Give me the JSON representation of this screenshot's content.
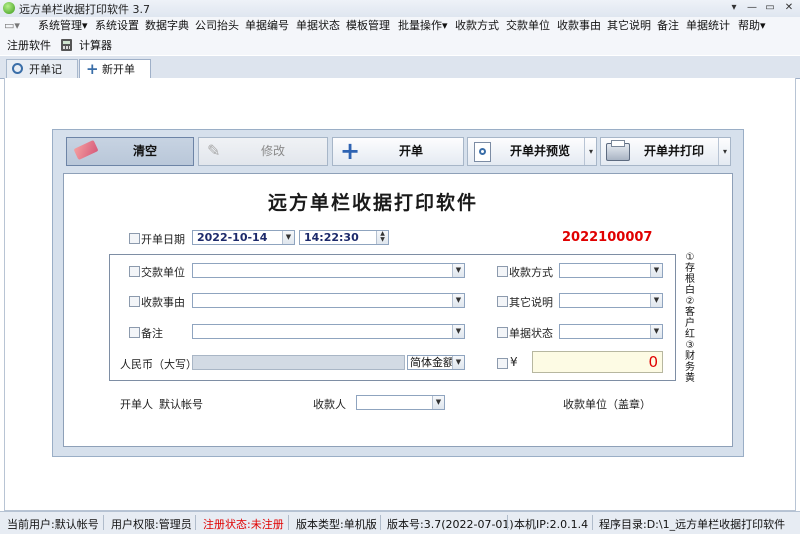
{
  "window": {
    "title": "远方单栏收据打印软件 3.7",
    "controls": [
      "▾",
      "—",
      "▭",
      "✕"
    ]
  },
  "menubar": {
    "items": [
      "系统管理",
      "系统设置",
      "数据字典",
      "公司抬头",
      "单据编号",
      "单据状态",
      "模板管理",
      "批量操作",
      "收款方式",
      "交款单位",
      "收款事由",
      "其它说明",
      "备注",
      "单据统计",
      "帮助"
    ]
  },
  "toolbar2": {
    "register": "注册软件",
    "calculator": "计算器"
  },
  "tabs": [
    {
      "label": "开单记录"
    },
    {
      "label": "新开单据"
    }
  ],
  "buttons": {
    "clear": "清空",
    "edit": "修改",
    "open": "开单",
    "open_preview": "开单并预览",
    "open_print": "开单并打印"
  },
  "form": {
    "heading": "远方单栏收据打印软件",
    "date_label": "开单日期",
    "date_value": "2022-10-14",
    "time_value": "14:22:30",
    "serial": "2022100007",
    "payer_label": "交款单位",
    "reason_label": "收款事由",
    "remark_label": "备注",
    "method_label": "收款方式",
    "other_label": "其它说明",
    "state_label": "单据状态",
    "rmb_label": "人民币（大写）",
    "amount_type": "简体金额",
    "yen": "¥",
    "amount": "0",
    "issuer_label": "开单人",
    "issuer_value": "默认帐号",
    "payee_label": "收款人",
    "unit_label": "收款单位（盖章）",
    "side_note": "①存根白②客户红③财务黄"
  },
  "status": {
    "user": "当前用户:默认帐号",
    "perm": "用户权限:管理员",
    "reg": "注册状态:未注册",
    "edition": "版本类型:单机版",
    "version": "版本号:3.7(2022-07-01)",
    "ip": "本机IP:2.0.1.4",
    "dir": "程序目录:D:\\1_远方单栏收据打印软件"
  }
}
